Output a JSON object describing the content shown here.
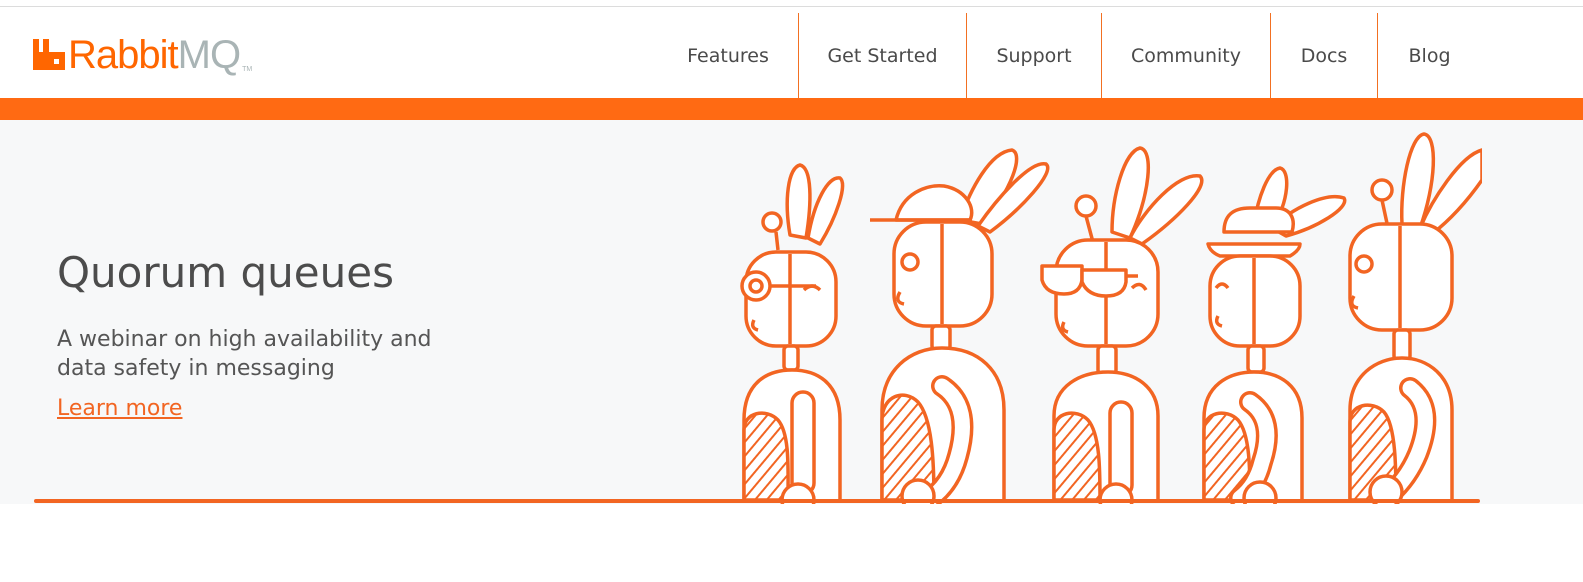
{
  "brand": {
    "name_part1": "Rabbit",
    "name_part2": "MQ",
    "trademark": "TM"
  },
  "nav": {
    "items": [
      {
        "label": "Features"
      },
      {
        "label": "Get Started"
      },
      {
        "label": "Support"
      },
      {
        "label": "Community"
      },
      {
        "label": "Docs"
      },
      {
        "label": "Blog"
      }
    ]
  },
  "hero": {
    "title": "Quorum queues",
    "subtitle": "A webinar on high availability and data safety in messaging",
    "link_label": "Learn more"
  },
  "colors": {
    "accent": "#ff6a13",
    "line": "#f26522",
    "hero_bg": "#f7f8f9",
    "text": "#4c4c4c",
    "logo_grey": "#a9b4b5"
  },
  "icons": {
    "logo": "rabbitmq-logo-icon",
    "illustration": "robot-rabbits-illustration"
  }
}
